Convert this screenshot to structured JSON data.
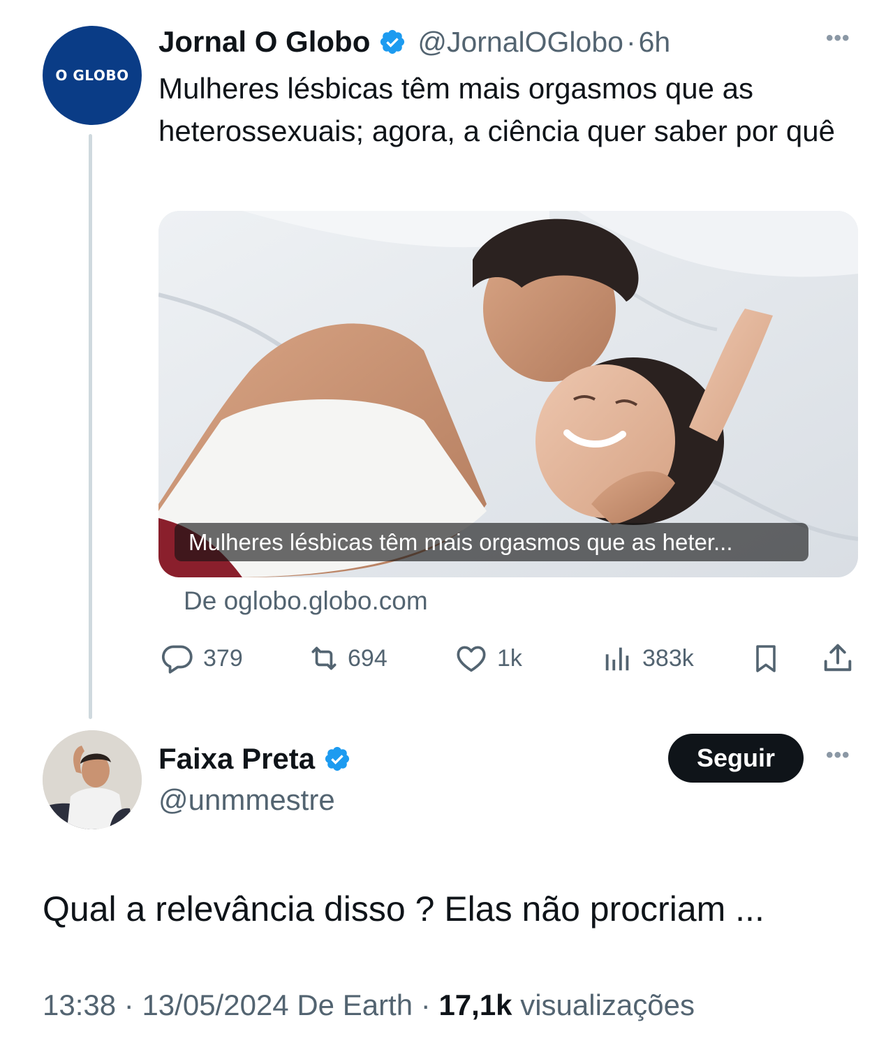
{
  "parent_tweet": {
    "avatar_text": "O GLOBO",
    "display_name": "Jornal O Globo",
    "verified": true,
    "handle": "@JornalOGlobo",
    "separator": "·",
    "time": "6h",
    "text": "Mulheres lésbicas têm mais orgasmos que as heterossexuais; agora, a ciência quer saber por quê",
    "media_caption": "Mulheres lésbicas têm mais orgasmos que as heter...",
    "source": "De oglobo.globo.com",
    "actions": {
      "replies": "379",
      "reposts": "694",
      "likes": "1k",
      "views": "383k"
    }
  },
  "reply_tweet": {
    "display_name": "Faixa Preta",
    "verified": true,
    "handle": "@unmmestre",
    "follow_label": "Seguir",
    "text": "Qual a relevância disso ? Elas não procriam ...",
    "time": "13:38",
    "date": "13/05/2024",
    "source": "De Earth",
    "separator": "·",
    "views_count": "17,1k",
    "views_label": "visualizações"
  },
  "colors": {
    "brand_globo": "#0a3c86",
    "verified_blue": "#1d9bf0",
    "text_primary": "#0f1419",
    "text_secondary": "#536471",
    "thread_line": "#cfd9de"
  }
}
